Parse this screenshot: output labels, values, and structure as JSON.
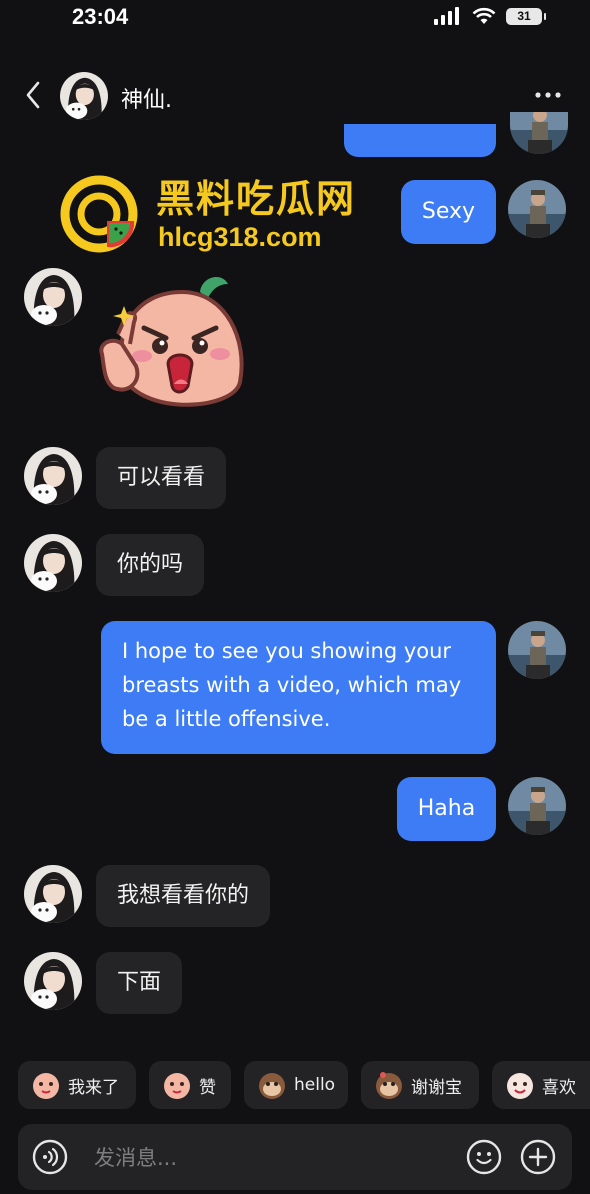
{
  "status": {
    "time": "23:04",
    "battery": "31"
  },
  "header": {
    "contact_name": "神仙."
  },
  "watermark": {
    "title": "黑料吃瓜网",
    "url": "hlcg318.com"
  },
  "messages": {
    "m1": "Sexy",
    "m2": "可以看看",
    "m3": "你的吗",
    "m4_lines": [
      "I hope to see you showing your",
      "breasts with a video, which may",
      "be a little offensive."
    ],
    "m5": "Haha",
    "m6": "我想看看你的",
    "m7": "下面"
  },
  "quick_replies": [
    "我来了",
    "赞",
    "hello",
    "谢谢宝",
    "喜欢"
  ],
  "input": {
    "placeholder": "发消息..."
  },
  "colors": {
    "background": "#111113",
    "outgoing_bubble": "#3d7cf4",
    "incoming_bubble": "#242426",
    "watermark": "#f6c91f"
  }
}
